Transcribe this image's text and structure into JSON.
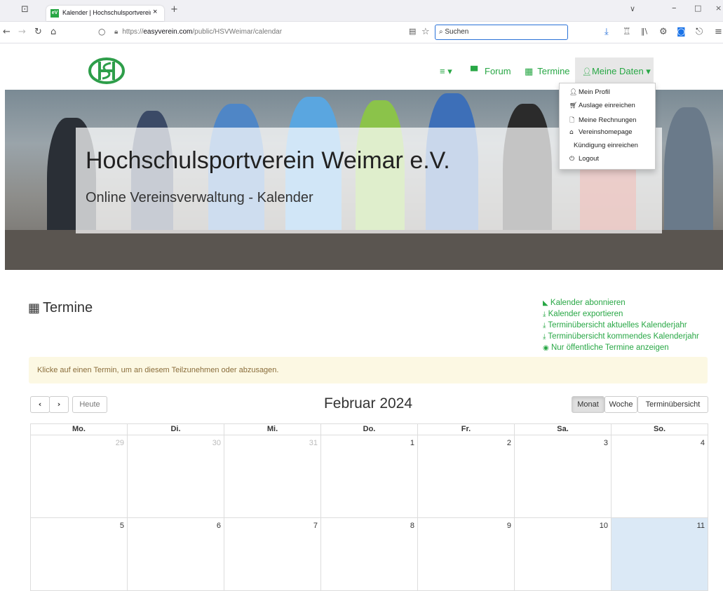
{
  "browser": {
    "tab_title": "Kalender | Hochschulsportverein Weimar",
    "tab_favicon": "eV",
    "url_scheme": "https://",
    "url_host": "easyverein.com",
    "url_path": "/public/HSVWeimar/calendar",
    "search_placeholder": "Suchen"
  },
  "site": {
    "logo": "HSV",
    "nav": {
      "menu_label": "≡ ▾",
      "forum": "Forum",
      "termine": "Termine",
      "meine_daten": "Meine Daten ▾"
    },
    "dropdown": [
      {
        "icon": "user-icon",
        "label": "Mein Profil"
      },
      {
        "icon": "cart-icon",
        "label": "Auslage einreichen"
      },
      {
        "icon": "file-icon",
        "label": "Meine Rechnungen"
      },
      {
        "icon": "home-icon",
        "label": "Vereinshomepage"
      },
      {
        "icon": "",
        "label": "Kündigung einreichen"
      },
      {
        "icon": "power-icon",
        "label": "Logout"
      }
    ],
    "hero_title": "Hochschulsportverein Weimar e.V.",
    "hero_subtitle": "Online Vereinsverwaltung - Kalender"
  },
  "page": {
    "title": "Termine",
    "links": [
      {
        "icon": "rss-icon",
        "label": "Kalender abonnieren"
      },
      {
        "icon": "download-icon",
        "label": "Kalender exportieren"
      },
      {
        "icon": "download-icon",
        "label": "Terminübersicht aktuelles Kalenderjahr"
      },
      {
        "icon": "download-icon",
        "label": "Terminübersicht kommendes Kalenderjahr"
      },
      {
        "icon": "eye-icon",
        "label": "Nur öffentliche Termine anzeigen"
      }
    ],
    "notice": "Klicke auf einen Termin, um an diesem Teilzunehmen oder abzusagen."
  },
  "calendar": {
    "today_label": "Heute",
    "month_title": "Februar 2024",
    "views": [
      "Monat",
      "Woche",
      "Terminübersicht"
    ],
    "active_view": "Monat",
    "weekdays": [
      "Mo.",
      "Di.",
      "Mi.",
      "Do.",
      "Fr.",
      "Sa.",
      "So."
    ],
    "week1": [
      "29",
      "30",
      "31",
      "1",
      "2",
      "3",
      "4"
    ],
    "week2": [
      "5",
      "6",
      "7",
      "8",
      "9",
      "10",
      "11"
    ]
  },
  "colors": {
    "accent": "#28a745",
    "today": "#dbe9f6",
    "notice_bg": "#fcf8e3"
  }
}
